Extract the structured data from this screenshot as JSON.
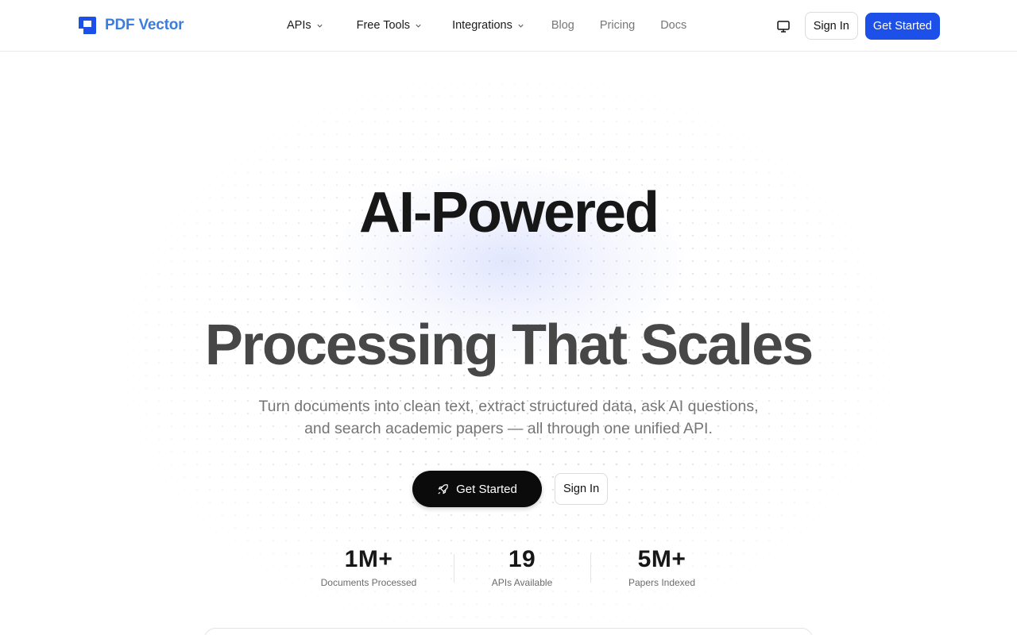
{
  "brand": {
    "name": "PDF Vector",
    "color": "#3b7ddd"
  },
  "nav": {
    "items": [
      {
        "label": "APIs",
        "dropdown": true
      },
      {
        "label": "Free Tools",
        "dropdown": true
      },
      {
        "label": "Integrations",
        "dropdown": true
      },
      {
        "label": "Blog",
        "dropdown": false
      },
      {
        "label": "Pricing",
        "dropdown": false
      },
      {
        "label": "Docs",
        "dropdown": false
      }
    ],
    "theme_icon": "monitor-icon",
    "sign_in": "Sign In",
    "get_started": "Get Started",
    "primary_color": "#1d50e8"
  },
  "hero": {
    "title_line1": "AI-Powered",
    "title_line2": "Processing That Scales",
    "subtitle": "Turn documents into clean text, extract structured data, ask AI questions, and search academic papers — all through one unified API.",
    "cta_primary": "Get Started",
    "cta_primary_icon": "rocket-icon",
    "cta_secondary": "Sign In"
  },
  "stats": [
    {
      "value": "1M+",
      "label": "Documents Processed"
    },
    {
      "value": "19",
      "label": "APIs Available"
    },
    {
      "value": "5M+",
      "label": "Papers Indexed"
    }
  ]
}
